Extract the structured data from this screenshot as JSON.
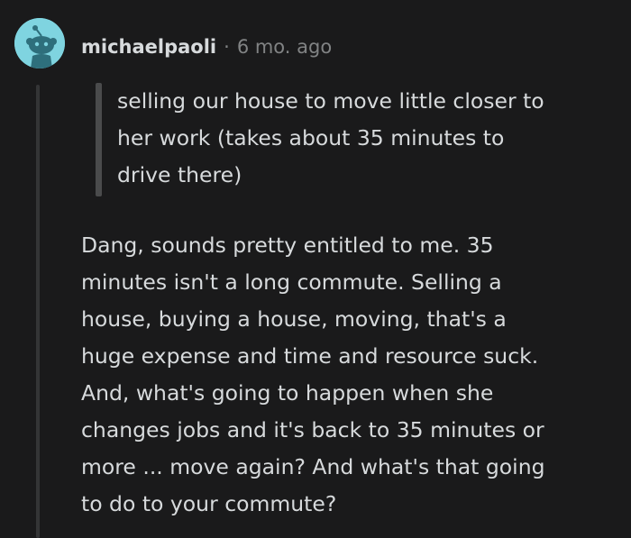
{
  "comment": {
    "username": "michaelpaoli",
    "separator": "·",
    "timestamp": "6 mo. ago",
    "avatar_icon": "reddit-snoo-avatar-icon",
    "quote_lines": [
      "selling our house to move little closer to",
      "her work (takes about 35 minutes to",
      "drive there)"
    ],
    "body_lines": [
      "Dang, sounds pretty entitled to me. 35",
      "minutes isn't a long commute. Selling a",
      "house, buying a house, moving, that's a",
      "huge expense and time and resource suck.",
      "And, what's going to happen when she",
      "changes jobs and it's back to 35 minutes or",
      "more ... move again? And what's that going",
      "to do to your commute?"
    ]
  },
  "colors": {
    "background": "#1a1a1b",
    "text": "#d7dadc",
    "muted": "#818384",
    "avatar_bg": "#7fd4e0",
    "quote_bar": "#4a4b4c",
    "thread_line": "#343536"
  }
}
